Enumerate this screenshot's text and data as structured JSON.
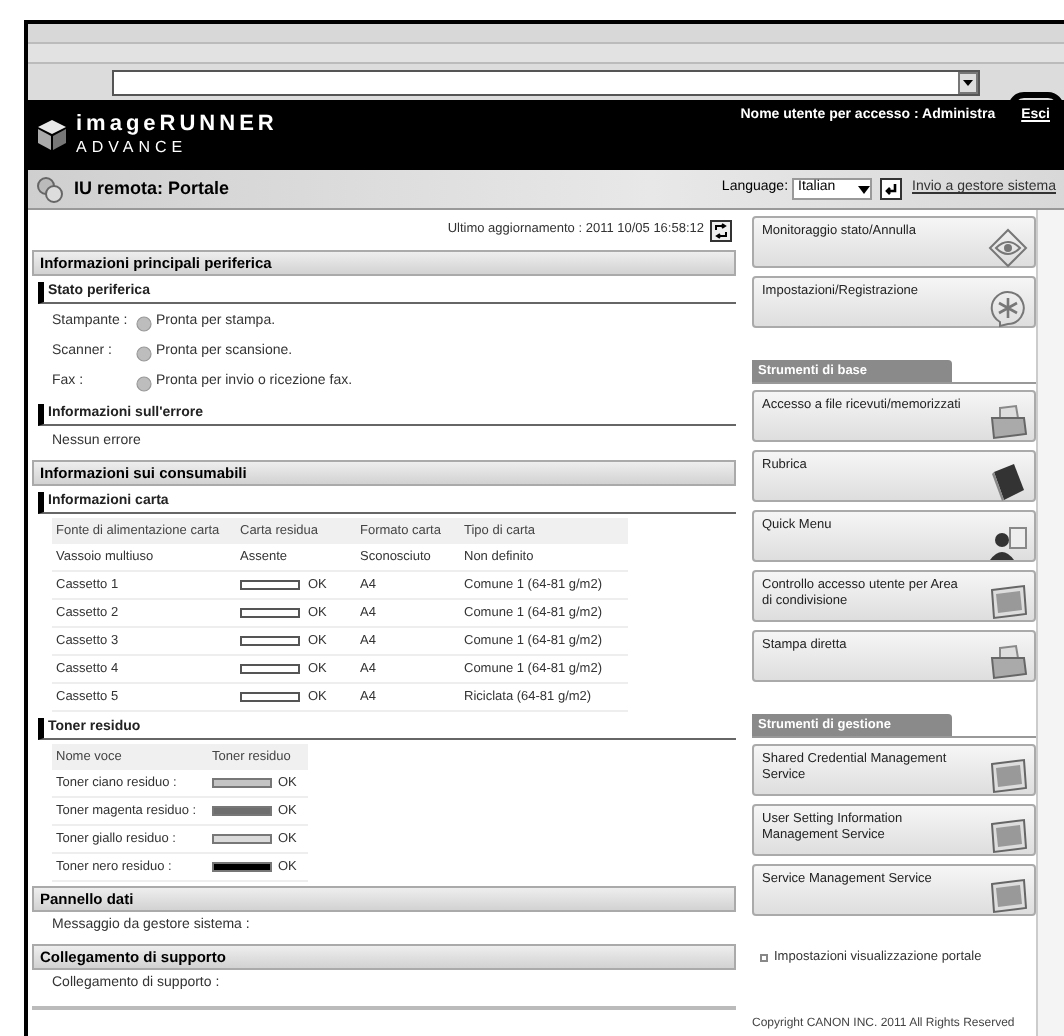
{
  "header": {
    "logo_title": "imageRUNNER",
    "logo_subtitle": "ADVANCE",
    "user_label": "Nome utente per accesso : Administra",
    "logout_button": "Esci"
  },
  "title_bar": {
    "title": "IU remota: Portale",
    "language_label": "Language:",
    "language": "Italian",
    "send_link": "Invio a gestore sistema"
  },
  "last_update": "Ultimo aggiornamento : 2011 10/05 16:58:12",
  "sections": [
    {
      "title": "Informazioni principali periferica",
      "subsections": [
        {
          "kind": "status",
          "title": "Stato periferica",
          "rows": [
            {
              "label": "Stampante :",
              "value": "Pronta per stampa."
            },
            {
              "label": "Scanner :",
              "value": "Pronta per scansione."
            },
            {
              "label": "Fax :",
              "value": "Pronta per invio o ricezione fax."
            }
          ]
        },
        {
          "kind": "text",
          "title": "Informazioni sull'errore",
          "text": "Nessun errore"
        }
      ]
    },
    {
      "title": "Informazioni sui consumabili",
      "subsections": [
        {
          "kind": "paper",
          "title": "Informazioni carta",
          "columns": [
            "Fonte di alimentazione carta",
            "Carta residua",
            "Formato carta",
            "Tipo di carta"
          ],
          "rows": [
            {
              "kind": "text",
              "source": "Vassoio multiuso",
              "remaining": "Assente",
              "size": "Sconosciuto",
              "type": "Non definito"
            },
            {
              "kind": "meter",
              "source": "Cassetto 1",
              "remaining": "OK",
              "size": "A4",
              "type": "Comune 1 (64-81 g/m2)"
            },
            {
              "kind": "meter",
              "source": "Cassetto 2",
              "remaining": "OK",
              "size": "A4",
              "type": "Comune 1 (64-81 g/m2)"
            },
            {
              "kind": "meter",
              "source": "Cassetto 3",
              "remaining": "OK",
              "size": "A4",
              "type": "Comune 1 (64-81 g/m2)"
            },
            {
              "kind": "meter",
              "source": "Cassetto 4",
              "remaining": "OK",
              "size": "A4",
              "type": "Comune 1 (64-81 g/m2)"
            },
            {
              "kind": "meter",
              "source": "Cassetto 5",
              "remaining": "OK",
              "size": "A4",
              "type": "Riciclata (64-81 g/m2)"
            }
          ]
        },
        {
          "kind": "toner",
          "title": "Toner residuo",
          "columns": [
            "Nome voce",
            "Toner residuo"
          ],
          "rows": [
            {
              "name": "Toner ciano residuo :",
              "color": "#c4c4c4",
              "level": 1,
              "status": "OK"
            },
            {
              "name": "Toner magenta residuo :",
              "color": "#6e6e6e",
              "level": 1,
              "status": "OK"
            },
            {
              "name": "Toner giallo residuo :",
              "color": "#dadada",
              "level": 1,
              "status": "OK"
            },
            {
              "name": "Toner nero residuo :",
              "color": "#000000",
              "level": 1,
              "status": "OK"
            }
          ]
        }
      ]
    },
    {
      "title": "Pannello dati",
      "text": "Messaggio da gestore sistema :"
    },
    {
      "title": "Collegamento di supporto",
      "text": "Collegamento di supporto :"
    }
  ],
  "sidebar": {
    "groups": [
      {
        "items": [
          "Monitoraggio stato/Annulla",
          "Impostazioni/Registrazione"
        ]
      },
      {
        "title": "Strumenti di base",
        "items": [
          "Accesso a file ricevuti/memorizzati",
          "Rubrica",
          "Quick Menu",
          "Controllo accesso utente per Area di condivisione",
          "Stampa diretta"
        ]
      },
      {
        "title": "Strumenti di gestione",
        "items": [
          "Shared Credential Management Service",
          "User Setting Information Management Service",
          "Service Management Service"
        ]
      }
    ],
    "portal_link": "Impostazioni visualizzazione portale"
  },
  "copyright": "Copyright CANON INC. 2011 All Rights Reserved"
}
